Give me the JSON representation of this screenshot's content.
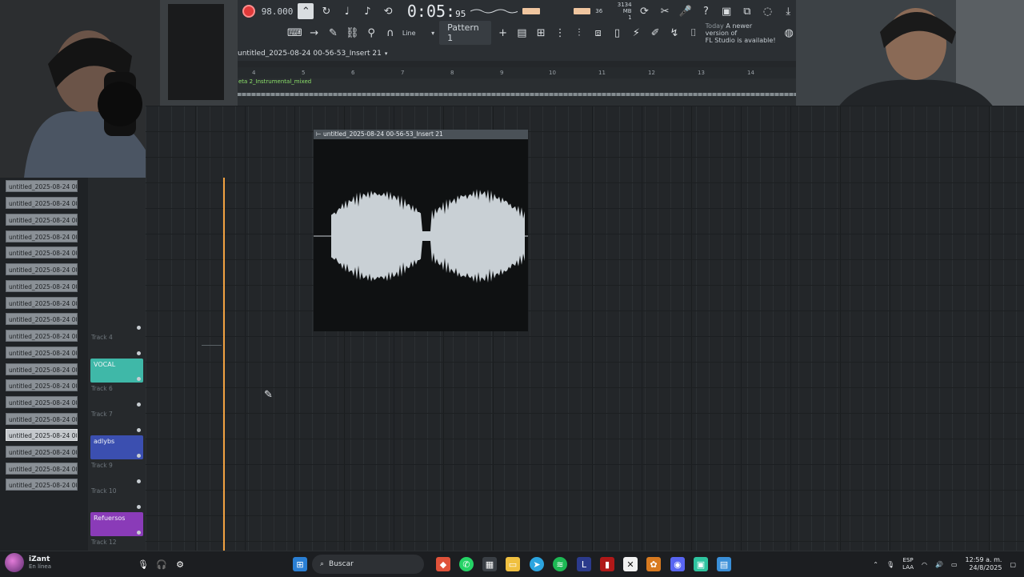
{
  "toolbar": {
    "tempo": "98.000",
    "time_main": "0:05",
    "time_sub": "95",
    "cpu_line1": "3134 MB",
    "cpu_line2": "1",
    "meter_value": "36",
    "snap_mode": "Line",
    "pattern_label": "Pattern 1",
    "news_line1": "Today",
    "news_line2": "A newer version of",
    "news_line3": "FL Studio is available!"
  },
  "playlist": {
    "title": "untitled_2025-08-24 00-56-53_Insert 21",
    "instrumental_label": "eta 2_Instrumental_mixed",
    "ruler_numbers": [
      "4",
      "5",
      "6",
      "7",
      "8",
      "9",
      "10",
      "11",
      "12",
      "13",
      "14"
    ]
  },
  "clip": {
    "name": "untitled_2025-08-24 00-56-53_Insert 21"
  },
  "browser": {
    "items": [
      "untitled_2025-08-24 00-...",
      "untitled_2025-08-24 00-...",
      "untitled_2025-08-24 00-...",
      "untitled_2025-08-24 00-...",
      "untitled_2025-08-24 00-...",
      "untitled_2025-08-24 00-...",
      "untitled_2025-08-24 00-...",
      "untitled_2025-08-24 00-...",
      "untitled_2025-08-24 00-...",
      "untitled_2025-08-24 00-...",
      "untitled_2025-08-24 00-...",
      "untitled_2025-08-24 00-...",
      "untitled_2025-08-24 00-...",
      "untitled_2025-08-24 00-...",
      "untitled_2025-08-24 00-...",
      "untitled_2025-08-24 00-...",
      "untitled_2025-08-24 00-...",
      "untitled_2025-08-24 00-...",
      "untitled_2025-08-24 00-..."
    ]
  },
  "tracks": {
    "track4": "Track 4",
    "vocal": "VOCAL",
    "track6": "Track 6",
    "track7": "Track 7",
    "adlybs": "adlybs",
    "track9": "Track 9",
    "track10": "Track 10",
    "refuersos": "Refuersos",
    "track12": "Track 12"
  },
  "colors": {
    "vocal": "#3fb8a8",
    "adlybs": "#3b4fb0",
    "refuersos": "#8a3bb8",
    "playhead": "#f0a040",
    "record": "#e03a3a"
  },
  "taskbar": {
    "username": "iZant",
    "status": "En línea",
    "search_label": "Buscar",
    "lang1": "ESP",
    "lang2": "LAA",
    "time": "12:59 a. m.",
    "date": "24/8/2025"
  }
}
